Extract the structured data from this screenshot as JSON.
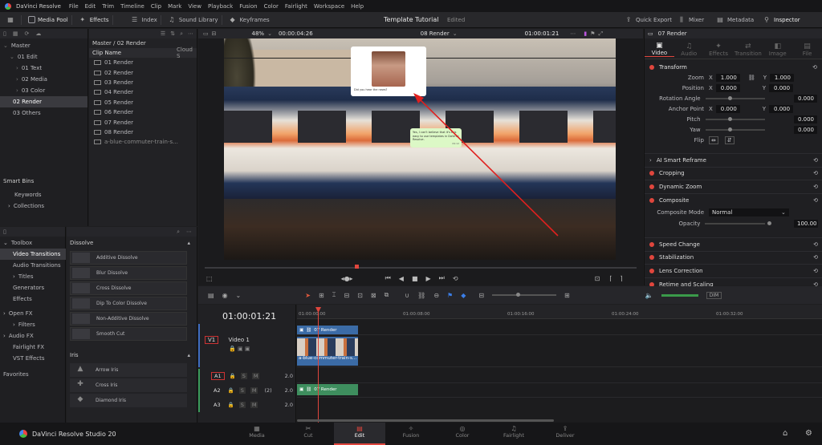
{
  "menubar": {
    "app": "DaVinci Resolve",
    "items": [
      "File",
      "Edit",
      "Trim",
      "Timeline",
      "Clip",
      "Mark",
      "View",
      "Playback",
      "Fusion",
      "Color",
      "Fairlight",
      "Workspace",
      "Help"
    ]
  },
  "toolbar": {
    "media_pool": "Media Pool",
    "effects": "Effects",
    "index": "Index",
    "sound_library": "Sound Library",
    "keyframes": "Keyframes",
    "project_title": "Template Tutorial",
    "project_status": "Edited",
    "quick_export": "Quick Export",
    "mixer": "Mixer",
    "metadata": "Metadata",
    "inspector": "Inspector"
  },
  "mediapool": {
    "path": "Master / 02 Render",
    "col_name": "Clip Name",
    "col_cloud": "Cloud S",
    "bins": [
      "Master",
      "01 Edit",
      "01 Text",
      "02 Media",
      "03 Color",
      "02 Render",
      "03 Others"
    ],
    "clips": [
      "01 Render",
      "02 Render",
      "03 Render",
      "04 Render",
      "05 Render",
      "06 Render",
      "07 Render",
      "08 Render",
      "a-blue-commuter-train-s..."
    ],
    "smart_bins": "Smart Bins",
    "smart_items": [
      "Keywords",
      "Collections"
    ]
  },
  "viewer": {
    "zoom": "48%",
    "src_tc": "00:00:04:26",
    "clip_name": "08 Render",
    "rec_tc": "01:00:01:21",
    "chat_left": "Did you hear the news?",
    "chat_right": "Yes, I can't believe that it's this easy to use templates in DaVinci Resolve.",
    "chat_time": "09:12"
  },
  "effects": {
    "categories": [
      "Toolbox",
      "Video Transitions",
      "Audio Transitions",
      "Titles",
      "Generators",
      "Effects",
      "Open FX",
      "Filters",
      "Audio FX",
      "Fairlight FX",
      "VST Effects",
      "Favorites"
    ],
    "group1": "Dissolve",
    "dissolves": [
      "Additive Dissolve",
      "Blur Dissolve",
      "Cross Dissolve",
      "Dip To Color Dissolve",
      "Non-Additive Dissolve",
      "Smooth Cut"
    ],
    "group2": "Iris",
    "iris": [
      "Arrow Iris",
      "Cross Iris",
      "Diamond Iris"
    ]
  },
  "inspector": {
    "clip": "07 Render",
    "tabs": [
      "Video",
      "Audio",
      "Effects",
      "Transition",
      "Image",
      "File"
    ],
    "transform": "Transform",
    "zoom_label": "Zoom",
    "zoom_x": "1.000",
    "zoom_y": "1.000",
    "pos_label": "Position",
    "pos_x": "0.000",
    "pos_y": "0.000",
    "rot_label": "Rotation Angle",
    "rot": "0.000",
    "anchor_label": "Anchor Point",
    "anchor_x": "0.000",
    "anchor_y": "0.000",
    "pitch_label": "Pitch",
    "pitch": "0.000",
    "yaw_label": "Yaw",
    "yaw": "0.000",
    "flip_label": "Flip",
    "smart_reframe": "AI Smart Reframe",
    "cropping": "Cropping",
    "dynamic_zoom": "Dynamic Zoom",
    "composite": "Composite",
    "comp_mode_label": "Composite Mode",
    "comp_mode": "Normal",
    "opacity_label": "Opacity",
    "opacity": "100.00",
    "speed_change": "Speed Change",
    "stabilization": "Stabilization",
    "lens_correction": "Lens Correction",
    "retime": "Retime and Scaling"
  },
  "timeline": {
    "tc": "01:00:01:21",
    "ruler": [
      "01:00:00:00",
      "01:00:08:00",
      "01:00:16:00",
      "01:00:24:00",
      "01:00:32:00"
    ],
    "v1": "V1",
    "v1_name": "Video 1",
    "a1": "A1",
    "a2": "A2",
    "a3": "A3",
    "a_vol": "2.0",
    "a2_ch": "(2)",
    "clip_v2": "07 Render",
    "clip_v1": "a-blue-commuter-train-s...",
    "clip_a": "07 Render",
    "dim": "DIM"
  },
  "pages": {
    "brand": "DaVinci Resolve Studio 20",
    "items": [
      "Media",
      "Cut",
      "Edit",
      "Fusion",
      "Color",
      "Fairlight",
      "Deliver"
    ],
    "active": "Edit"
  }
}
